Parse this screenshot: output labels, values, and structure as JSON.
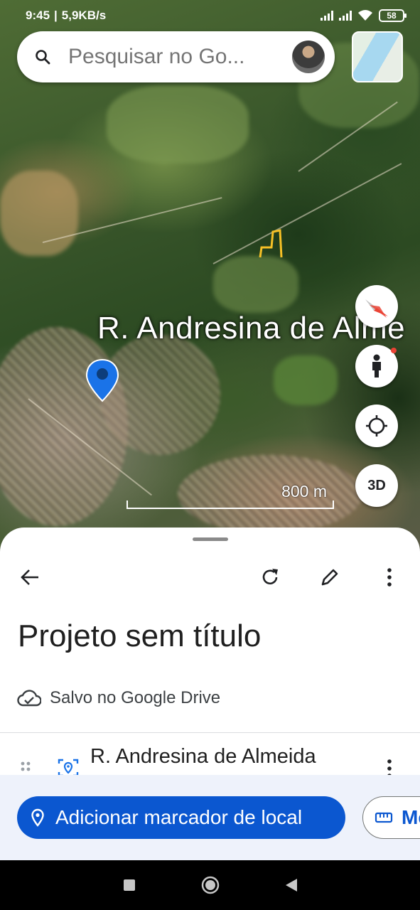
{
  "status_bar": {
    "time": "9:45",
    "speed": "5,9KB/s",
    "battery": "58"
  },
  "search": {
    "placeholder": "Pesquisar no Go..."
  },
  "map": {
    "place_label": "R. Andresina de Alme",
    "scale_label": "800 m",
    "button_3d": "3D",
    "pin_color": "#1a73e8",
    "boundary_color": "#f6c026"
  },
  "sheet": {
    "title": "Projeto sem título",
    "saved_status": "Salvo no Google Drive",
    "item_label": "R. Andresina de Almeida",
    "add_marker_label": "Adicionar marcador de local",
    "measure_label": "Me"
  },
  "colors": {
    "primary": "#0b57d0",
    "accent_red": "#ea4335"
  },
  "icons": {
    "search": "search-icon",
    "compass": "compass-icon",
    "pegman": "pegman-icon",
    "my_location": "my-location-icon",
    "back": "back-arrow-icon",
    "refresh": "refresh-icon",
    "edit": "pencil-icon",
    "more": "more-vert-icon",
    "cloud": "cloud-check-icon",
    "drag": "drag-indicator-icon",
    "place": "place-marker-icon",
    "ruler": "ruler-icon"
  }
}
